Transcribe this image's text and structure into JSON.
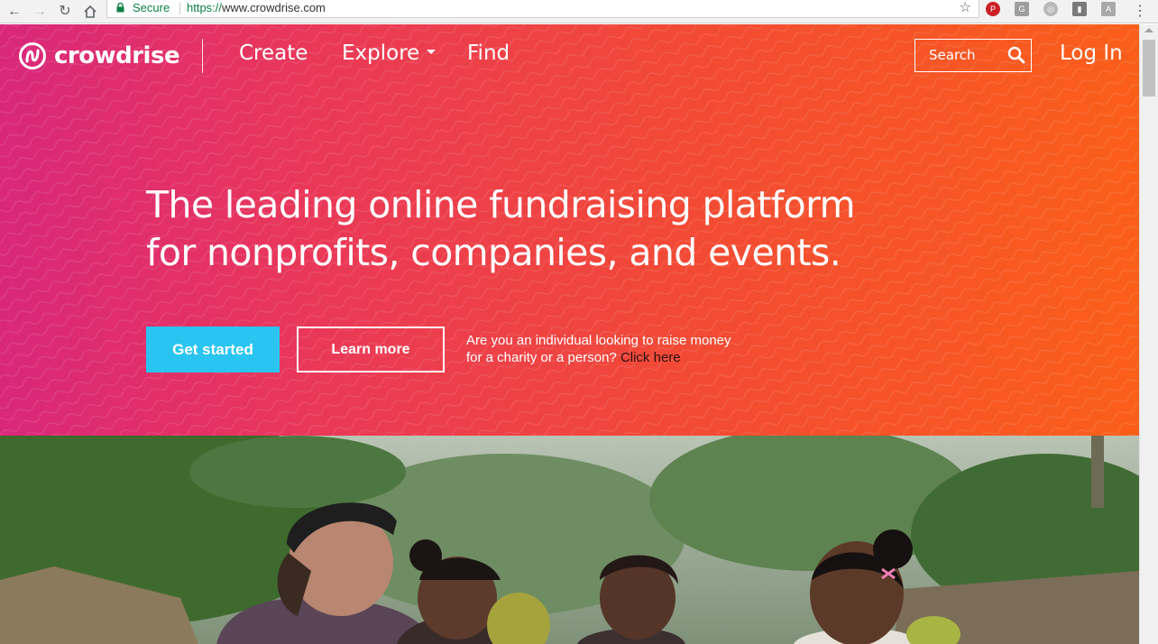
{
  "browser": {
    "security_label": "Secure",
    "url_scheme": "https://",
    "url_rest": "www.crowdrise.com",
    "extensions": [
      {
        "name": "pinterest",
        "color": "#cb1f27",
        "glyph": "P"
      },
      {
        "name": "g-extension",
        "color": "#9e9e9e",
        "glyph": "G"
      },
      {
        "name": "circle-extension",
        "color": "#b0b0b0",
        "glyph": "◎"
      },
      {
        "name": "evernote-extension",
        "color": "#7a7a7a",
        "glyph": "▮"
      },
      {
        "name": "pdf-extension",
        "color": "#a8a8a8",
        "glyph": "A"
      }
    ]
  },
  "brand": {
    "name": "crowdrise",
    "logo_color": "#ffffff"
  },
  "nav": {
    "create": "Create",
    "explore": "Explore",
    "find": "Find",
    "search_placeholder": "Search",
    "login": "Log In"
  },
  "hero": {
    "headline_line1": "The leading online fundraising platform",
    "headline_line2": "for nonprofits, companies, and events.",
    "cta_primary": "Get started",
    "cta_secondary": "Learn more",
    "individual_line1": "Are you an individual looking to raise money",
    "individual_line2": "for a charity or a person?",
    "click_here": "Click here",
    "gradient_start": "#d9277b",
    "gradient_end": "#fa5f19",
    "cta_primary_color": "#29c5f0"
  },
  "photo": {
    "description_icon": "women-laughing-photo"
  }
}
